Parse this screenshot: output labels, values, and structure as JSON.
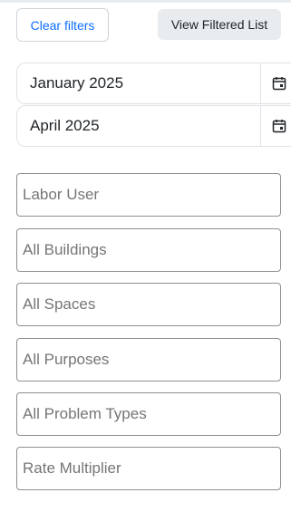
{
  "toolbar": {
    "clear_filters_label": "Clear filters",
    "view_filtered_label": "View Filtered List"
  },
  "date_range": {
    "start": "January 2025",
    "end": "April 2025",
    "icon": "calendar-icon"
  },
  "filters": {
    "labor_user": "Labor User",
    "buildings": "All Buildings",
    "spaces": "All Spaces",
    "purposes": "All Purposes",
    "problem_types": "All Problem Types",
    "rate_multiplier": "Rate Multiplier"
  },
  "colors": {
    "accent": "#0d6efd",
    "muted_text": "#757575",
    "button_gray": "#e9ecef"
  }
}
